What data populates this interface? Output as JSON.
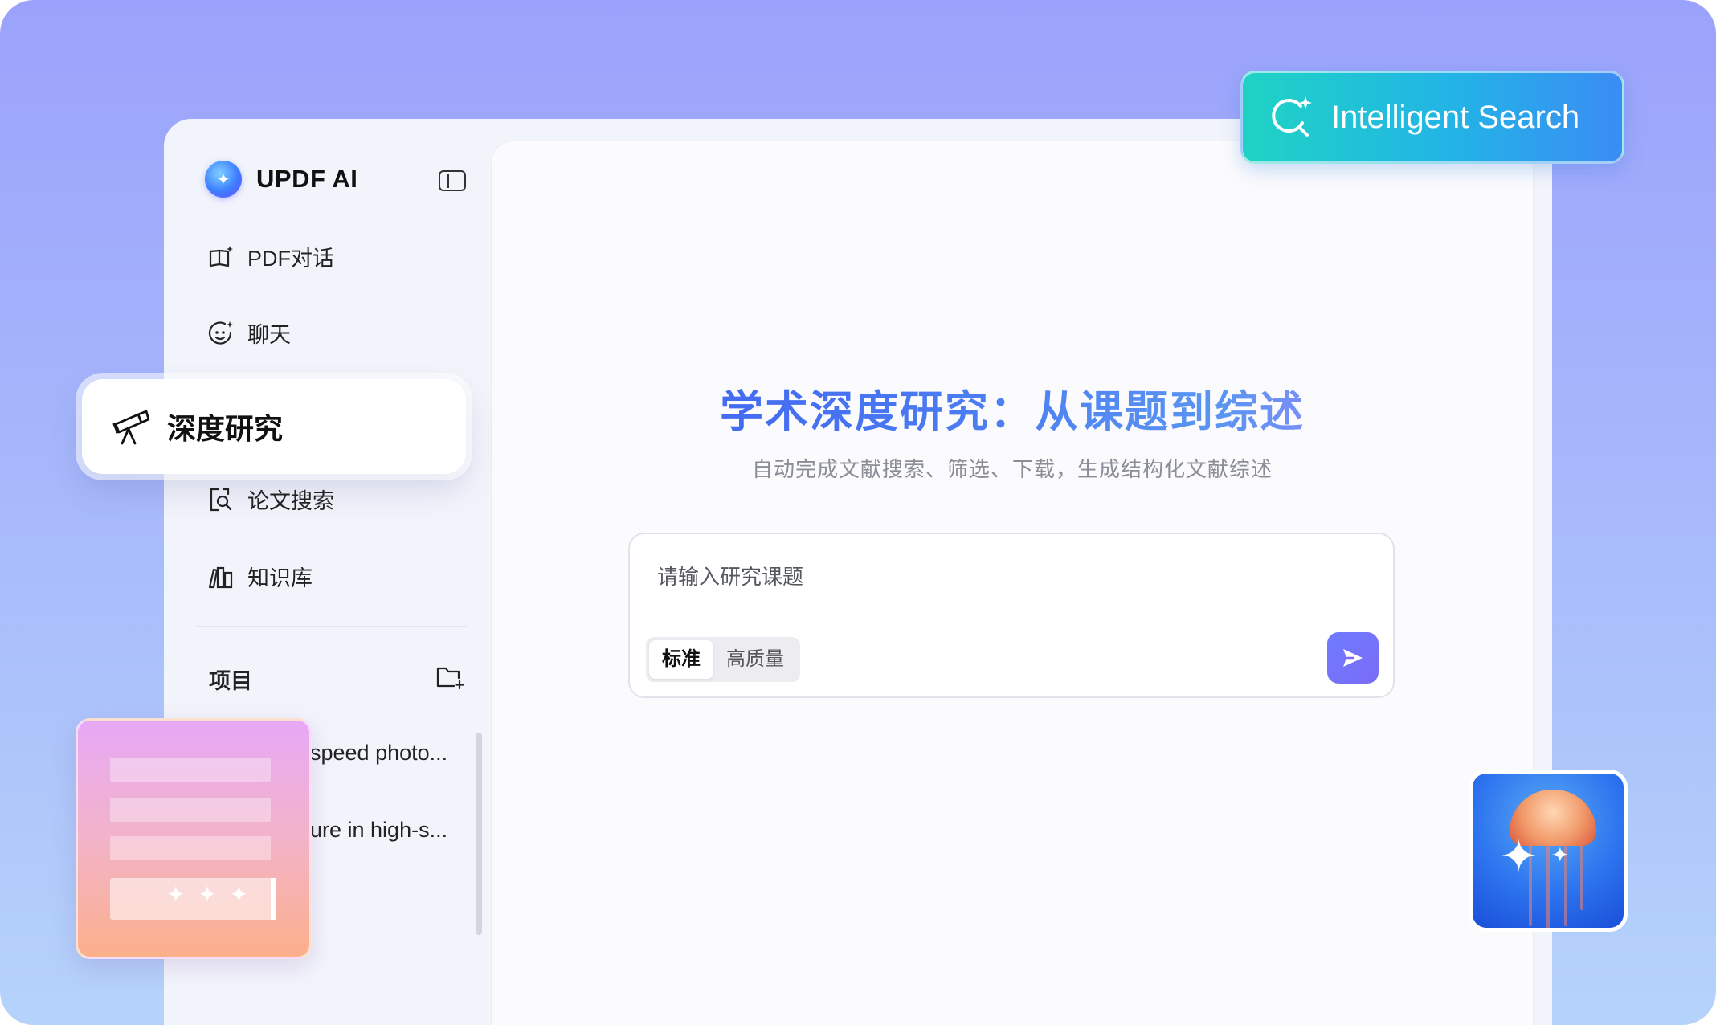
{
  "app": {
    "name": "UPDF AI"
  },
  "sidebar": {
    "items": [
      {
        "label": "PDF对话",
        "icon": "book-sparkle-icon"
      },
      {
        "label": "聊天",
        "icon": "chat-face-icon"
      },
      {
        "label": "深度研究",
        "icon": "telescope-icon",
        "active": true
      },
      {
        "label": "论文搜索",
        "icon": "doc-search-icon"
      },
      {
        "label": "知识库",
        "icon": "books-icon"
      }
    ],
    "projects_label": "项目",
    "projects": [
      {
        "label": "speed photo..."
      },
      {
        "label": "ure in high-s..."
      }
    ]
  },
  "badge": {
    "label": "Intelligent Search",
    "icon": "search-sparkle-icon"
  },
  "main": {
    "title": "学术深度研究：从课题到综述",
    "subtitle": "自动完成文献搜索、筛选、下载，生成结构化文献综述",
    "input_placeholder": "请输入研究课题",
    "modes": [
      {
        "label": "标准",
        "selected": true
      },
      {
        "label": "高质量",
        "selected": false
      }
    ]
  },
  "colors": {
    "accent": "#6f7cff",
    "badge_start": "#1fd3c4",
    "badge_end": "#3b8cf4",
    "title_gradient_start": "#3c5cf0",
    "title_gradient_end": "#c97bff"
  }
}
